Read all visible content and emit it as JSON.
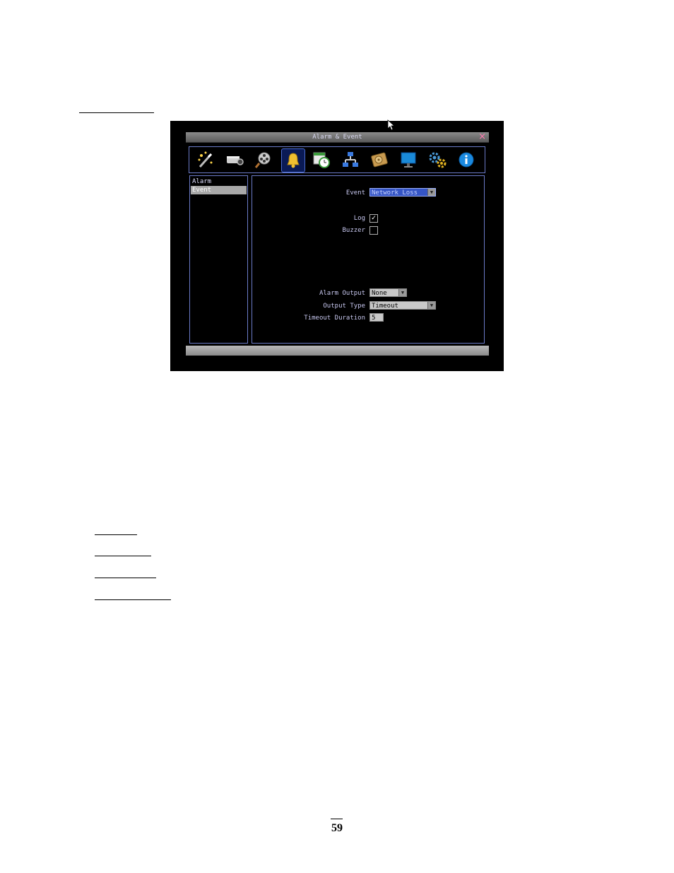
{
  "window": {
    "title": "Alarm & Event",
    "close_label": "×"
  },
  "toolbar": {
    "icons": [
      "wizard-icon",
      "camera-icon",
      "film-search-icon",
      "bell-icon",
      "schedule-icon",
      "network-icon",
      "hdd-icon",
      "monitor-icon",
      "gears-icon",
      "info-icon"
    ],
    "selected": "bell-icon"
  },
  "sidebar": {
    "items": [
      {
        "label": "Alarm",
        "selected": false
      },
      {
        "label": "Event",
        "selected": true
      }
    ]
  },
  "form": {
    "event_label": "Event",
    "event_value": "Network Loss",
    "log_label": "Log",
    "log_checked": true,
    "buzzer_label": "Buzzer",
    "buzzer_checked": false,
    "alarm_output_label": "Alarm Output",
    "alarm_output_value": "None",
    "output_type_label": "Output Type",
    "output_type_value": "Timeout",
    "timeout_duration_label": "Timeout Duration",
    "timeout_duration_value": "5"
  },
  "page": {
    "number": "59"
  },
  "colors": {
    "screen_bg": "#000000",
    "border_blue": "#6b7bc8",
    "select_blue": "#3555c5",
    "selected_item_gray": "#a8a8a8"
  }
}
